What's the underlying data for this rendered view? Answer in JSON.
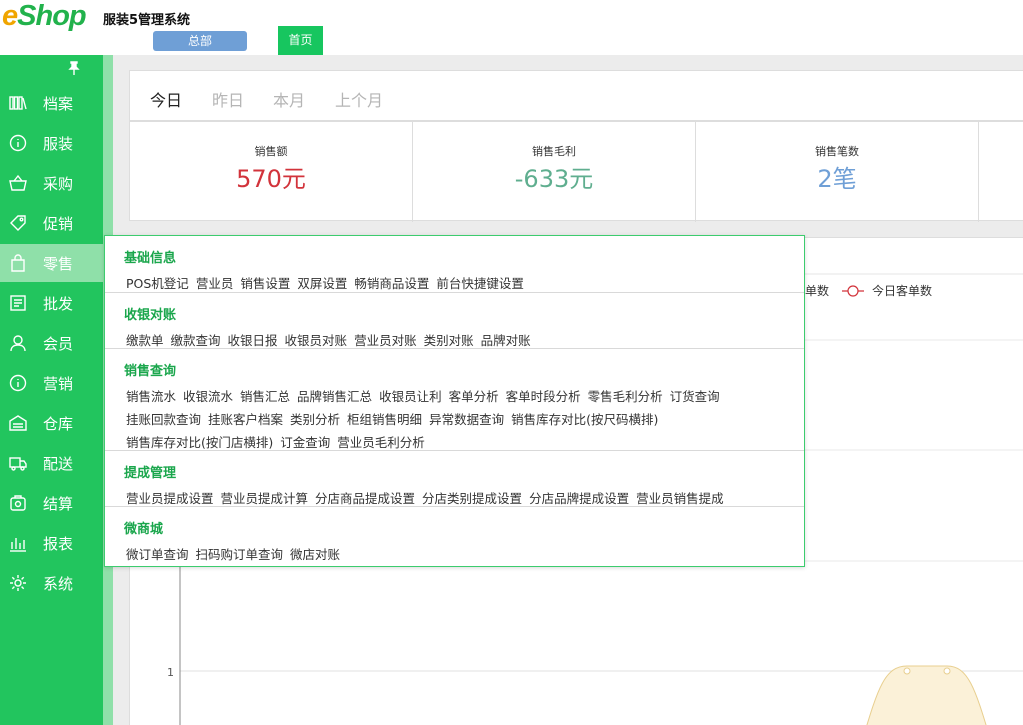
{
  "header": {
    "logo_e": "e",
    "logo_rest": "Shop",
    "app_title": "服装5管理系统",
    "hq_button": "总部",
    "home_tab": "首页"
  },
  "sidebar": {
    "pin_icon": "pin-icon",
    "items": [
      {
        "label": "档案",
        "icon": "archive-icon"
      },
      {
        "label": "服装",
        "icon": "info-icon"
      },
      {
        "label": "采购",
        "icon": "basket-icon"
      },
      {
        "label": "促销",
        "icon": "tag-icon"
      },
      {
        "label": "零售",
        "icon": "bag-icon",
        "active": true
      },
      {
        "label": "批发",
        "icon": "receipt-icon"
      },
      {
        "label": "会员",
        "icon": "user-icon"
      },
      {
        "label": "营销",
        "icon": "info-icon"
      },
      {
        "label": "仓库",
        "icon": "warehouse-icon"
      },
      {
        "label": "配送",
        "icon": "truck-icon"
      },
      {
        "label": "结算",
        "icon": "settle-icon"
      },
      {
        "label": "报表",
        "icon": "chart-icon"
      },
      {
        "label": "系统",
        "icon": "gear-icon"
      }
    ]
  },
  "date_tabs": [
    "今日",
    "昨日",
    "本月",
    "上个月"
  ],
  "stats": [
    {
      "title": "销售额",
      "value": "570元",
      "color": "#d2333b"
    },
    {
      "title": "销售毛利",
      "value": "-633元",
      "color": "#5fae8f"
    },
    {
      "title": "销售笔数",
      "value": "2笔",
      "color": "#6f9fd6"
    }
  ],
  "chart": {
    "legend_partial": "单数",
    "legend_today": "今日客单数",
    "y_tick": "1",
    "color": "#f0dfb4"
  },
  "menu": [
    {
      "title": "基础信息",
      "items": [
        "POS机登记",
        "营业员",
        "销售设置",
        "双屏设置",
        "畅销商品设置",
        "前台快捷键设置"
      ]
    },
    {
      "title": "收银对账",
      "items": [
        "缴款单",
        "缴款查询",
        "收银日报",
        "收银员对账",
        "营业员对账",
        "类别对账",
        "品牌对账"
      ]
    },
    {
      "title": "销售查询",
      "items": [
        "销售流水",
        "收银流水",
        "销售汇总",
        "品牌销售汇总",
        "收银员让利",
        "客单分析",
        "客单时段分析",
        "零售毛利分析",
        "订货查询",
        "挂账回款查询",
        "挂账客户档案",
        "类别分析",
        "柜组销售明细",
        "异常数据查询",
        "销售库存对比(按尺码横排)",
        "销售库存对比(按门店横排)",
        "订金查询",
        "营业员毛利分析"
      ]
    },
    {
      "title": "提成管理",
      "items": [
        "营业员提成设置",
        "营业员提成计算",
        "分店商品提成设置",
        "分店类别提成设置",
        "分店品牌提成设置",
        "营业员销售提成"
      ]
    },
    {
      "title": "微商城",
      "items": [
        "微订单查询",
        "扫码购订单查询",
        "微店对账"
      ]
    }
  ]
}
